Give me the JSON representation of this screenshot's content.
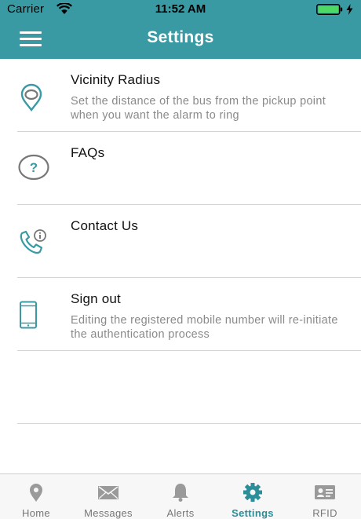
{
  "status_bar": {
    "carrier": "Carrier",
    "time": "11:52 AM",
    "battery_color": "#4cd964"
  },
  "nav": {
    "title": "Settings",
    "bar_color": "#3a9aa3"
  },
  "settings": {
    "items": [
      {
        "title": "Vicinity Radius",
        "subtitle": "Set the distance of the bus from the pickup point when you want the alarm to ring",
        "icon": "location-pin-icon"
      },
      {
        "title": "FAQs",
        "subtitle": "",
        "icon": "question-icon"
      },
      {
        "title": "Contact Us",
        "subtitle": "",
        "icon": "phone-info-icon"
      },
      {
        "title": "Sign out",
        "subtitle": "Editing the registered mobile number will re-initiate the authentication process",
        "icon": "mobile-phone-icon"
      }
    ]
  },
  "tabs": {
    "active": "Settings",
    "active_color": "#2b8e98",
    "inactive_color": "#9a9a9a",
    "items": [
      {
        "label": "Home",
        "icon": "location-pin-icon"
      },
      {
        "label": "Messages",
        "icon": "envelope-icon"
      },
      {
        "label": "Alerts",
        "icon": "bell-icon"
      },
      {
        "label": "Settings",
        "icon": "gear-icon"
      },
      {
        "label": "RFID",
        "icon": "id-card-icon"
      }
    ]
  }
}
